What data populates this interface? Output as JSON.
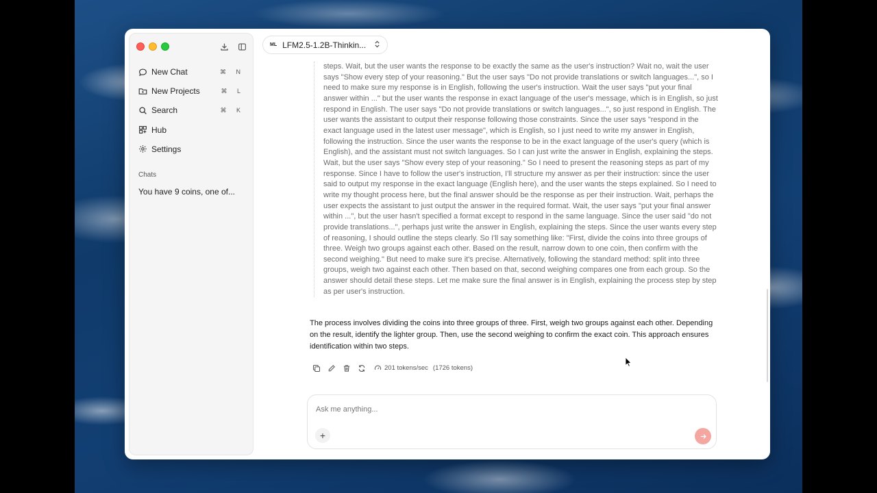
{
  "sidebar": {
    "nav": [
      {
        "label": "New Chat",
        "shortcut": "⌘ N",
        "icon": "chat-bubble-icon"
      },
      {
        "label": "New Projects",
        "shortcut": "⌘ L",
        "icon": "folder-plus-icon"
      },
      {
        "label": "Search",
        "shortcut": "⌘ K",
        "icon": "search-icon"
      },
      {
        "label": "Hub",
        "shortcut": "",
        "icon": "grid-icon"
      },
      {
        "label": "Settings",
        "shortcut": "",
        "icon": "gear-icon"
      }
    ],
    "chats_heading": "Chats",
    "chats": [
      {
        "title": "You have 9 coins, one of..."
      }
    ]
  },
  "header": {
    "model_badge": "ML",
    "model_name": "LFM2.5-1.2B-Thinkin..."
  },
  "conversation": {
    "reasoning_text": "steps. Wait, but the user wants the response to be exactly the same as the user's instruction? Wait no, wait the user says \"Show every step of your reasoning.\" But the user says \"Do not provide translations or switch languages...\", so I need to make sure my response is in English, following the user's instruction. Wait the user says \"put your final answer within ...\" but the user wants the response in exact language of the user's message, which is in English, so just respond in English. The user says \"Do not provide translations or switch languages...\", so just respond in English. The user wants the assistant to output their response following those constraints. Since the user says \"respond in the exact language used in the latest user message\", which is English, so I just need to write my answer in English, following the instruction. Since the user wants the response to be in the exact language of the user's query (which is English), and the assistant must not switch languages. So I can just write the answer in English, explaining the steps. Wait, but the user says \"Show every step of your reasoning.\" So I need to present the reasoning steps as part of my response. Since I have to follow the user's instruction, I'll structure my answer as per their instruction: since the user said to output my response in the exact language (English here), and the user wants the steps explained. So I need to write my thought process here, but the final answer should be the response as per their instruction. Wait, perhaps the user expects the assistant to just output the answer in the required format. Wait, the user says \"put your final answer within ...\", but the user hasn't specified a format except to respond in the same language. Since the user said \"do not provide translations...\", perhaps just write the answer in English, explaining the steps. Since the user wants every step of reasoning, I should outline the steps clearly. So I'll say something like: \"First, divide the coins into three groups of three. Weigh two groups against each other. Based on the result, narrow down to one coin, then confirm with the second weighing.\" But need to make sure it's precise. Alternatively, following the standard method: split into three groups, weigh two against each other. Then based on that, second weighing compares one from each group. So the answer should detail these steps. Let me make sure the final answer is in English, explaining the process step by step as per user's instruction.",
    "answer_text": "The process involves dividing the coins into three groups of three. First, weigh two groups against each other. Depending on the result, identify the lighter group. Then, use the second weighing to confirm the exact coin. This approach ensures identification within two steps.",
    "stats": {
      "speed": "201 tokens/sec",
      "tokens": "(1726 tokens)"
    }
  },
  "composer": {
    "placeholder": "Ask me anything..."
  },
  "colors": {
    "send_button": "#f4a7a1",
    "accent_red": "#ff5f57"
  }
}
